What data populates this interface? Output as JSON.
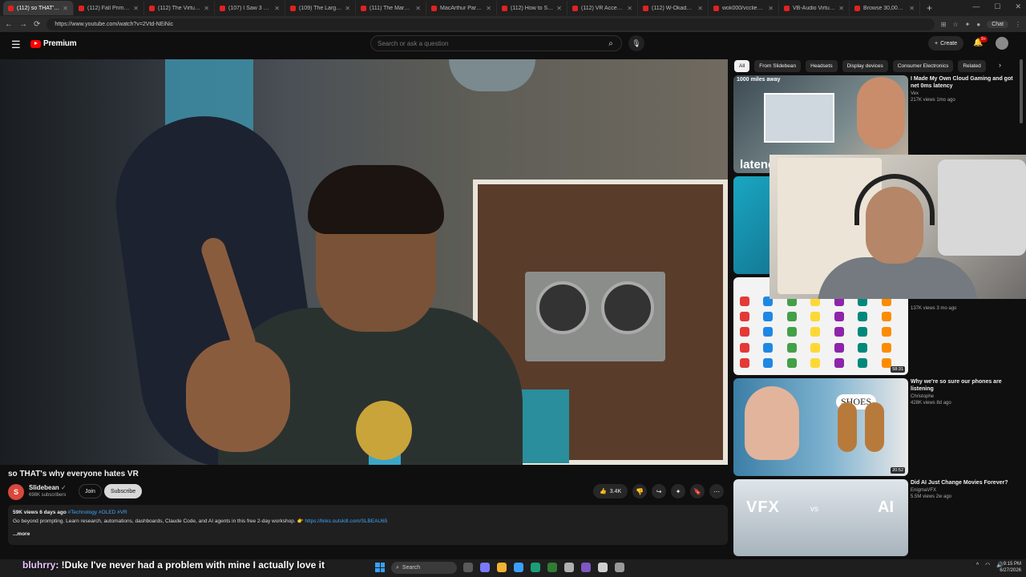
{
  "browser": {
    "tabs": [
      {
        "title": "(112) so THAT's w",
        "active": true
      },
      {
        "title": "(112) Fall Prime Day",
        "active": false
      },
      {
        "title": "(112) The Virtual Real",
        "active": false
      },
      {
        "title": "(107) I Saw 3 Hours o",
        "active": false
      },
      {
        "title": "(109) The Largest Econ",
        "active": false
      },
      {
        "title": "(111) The Marvel Cinem",
        "active": false
      },
      {
        "title": "MacArthur Park - Los",
        "active": false
      },
      {
        "title": "(112) How to Setup O",
        "active": false
      },
      {
        "title": "(112) VR Accessories",
        "active": false
      },
      {
        "title": "(112) W-Okada Voice",
        "active": false
      },
      {
        "title": "wok000/vcclient000",
        "active": false
      },
      {
        "title": "VB-Audio Virtual Apps",
        "active": false
      },
      {
        "title": "Browse 30,000+ AI Vo",
        "active": false
      }
    ],
    "url": "https://www.youtube.com/watch?v=2Vtd-NEiNic",
    "chat_label": "Chat"
  },
  "masthead": {
    "logo_text": "Premium",
    "search_placeholder": "Search or ask a question",
    "create_label": "Create",
    "notification_count": "9+"
  },
  "video": {
    "title": "so THAT's why everyone hates VR",
    "channel": "Slidebean",
    "channel_initial": "S",
    "subscribers": "698K subscribers",
    "join_label": "Join",
    "subscribe_label": "Subscribe",
    "likes": "3.4K",
    "views_age": "59K views  6 days ago",
    "tags": "#Technology #OLED #VR",
    "description": "Go beyond prompting. Learn research, automations, dashboards, Claude Code, and AI agents in this free 2-day workshop. 👉",
    "description_link": "https://links.outskill.com/SLBEAU65",
    "more_label": "...more"
  },
  "chips": [
    "All",
    "From Slidebean",
    "Headsets",
    "Display devices",
    "Consumer Electronics",
    "Related"
  ],
  "recommendations": [
    {
      "title": "I Made My Own Cloud Gaming and got net 0ms latency",
      "channel": "Vex",
      "stats": "217K views  1mo ago",
      "duration": "",
      "thumb_text": "1000 miles away",
      "thumb_big": "latency 0ms"
    },
    {
      "title": "",
      "channel": "",
      "stats": "",
      "duration": ""
    },
    {
      "title": "",
      "channel": "",
      "stats": "137K views  3 mo ago",
      "duration": "58:31"
    },
    {
      "title": "Why we're so sure our phones are listening",
      "channel": "Christophe",
      "stats": "428K views  8d ago",
      "duration": "20:52",
      "thumb_text": "SHOES"
    },
    {
      "title": "Did AI Just Change Movies Forever?",
      "channel": "EnigmaVFX",
      "stats": "5.5M views  2w ago",
      "duration": "",
      "thumb_left": "VFX",
      "thumb_vs": "vs",
      "thumb_right": "AI"
    }
  ],
  "chat_overlay": {
    "user": "bluhrry",
    "message": ": !Duke I've never had a problem with mine I actually love it"
  },
  "taskbar": {
    "search_label": "Search",
    "time": "9:15 PM",
    "date": "6/27/2026"
  },
  "colors": {
    "brand_red": "#ff0000",
    "link_blue": "#3ea6ff",
    "background": "#0f0f0f"
  }
}
